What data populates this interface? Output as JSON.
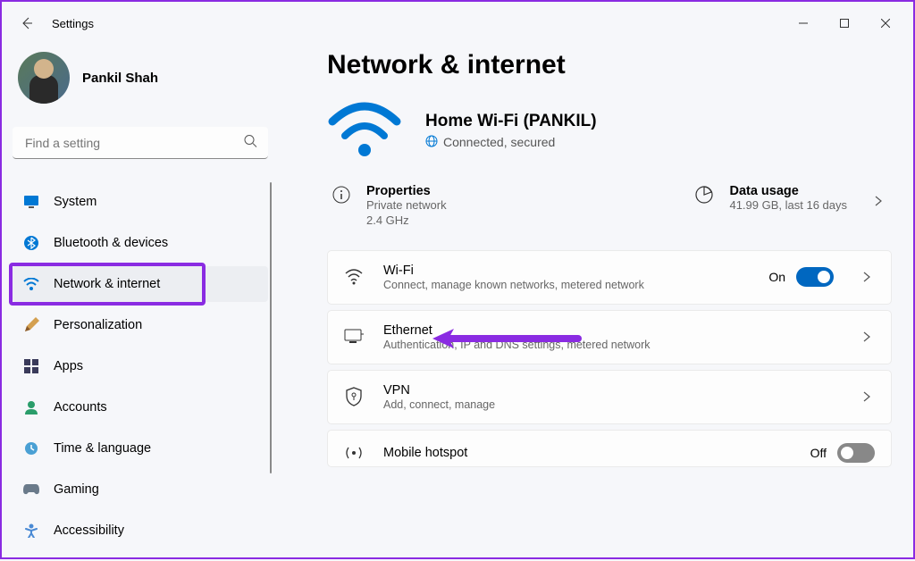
{
  "window": {
    "title": "Settings"
  },
  "user": {
    "name": "Pankil Shah"
  },
  "search": {
    "placeholder": "Find a setting"
  },
  "sidebar": {
    "items": [
      {
        "label": "System",
        "icon": "system"
      },
      {
        "label": "Bluetooth & devices",
        "icon": "bluetooth"
      },
      {
        "label": "Network & internet",
        "icon": "network",
        "active": true
      },
      {
        "label": "Personalization",
        "icon": "personalization"
      },
      {
        "label": "Apps",
        "icon": "apps"
      },
      {
        "label": "Accounts",
        "icon": "accounts"
      },
      {
        "label": "Time & language",
        "icon": "time"
      },
      {
        "label": "Gaming",
        "icon": "gaming"
      },
      {
        "label": "Accessibility",
        "icon": "accessibility"
      }
    ]
  },
  "page": {
    "heading": "Network & internet",
    "status": {
      "ssid": "Home Wi-Fi (PANKIL)",
      "state": "Connected, secured"
    },
    "properties": {
      "title": "Properties",
      "subtitle1": "Private network",
      "subtitle2": "2.4 GHz"
    },
    "datausage": {
      "title": "Data usage",
      "subtitle": "41.99 GB, last 16 days"
    },
    "items": {
      "wifi": {
        "title": "Wi-Fi",
        "subtitle": "Connect, manage known networks, metered network",
        "toggle_label": "On",
        "toggle": "on"
      },
      "ethernet": {
        "title": "Ethernet",
        "subtitle": "Authentication, IP and DNS settings, metered network"
      },
      "vpn": {
        "title": "VPN",
        "subtitle": "Add, connect, manage"
      },
      "hotspot": {
        "title": "Mobile hotspot",
        "toggle_label": "Off",
        "toggle": "off"
      }
    }
  }
}
